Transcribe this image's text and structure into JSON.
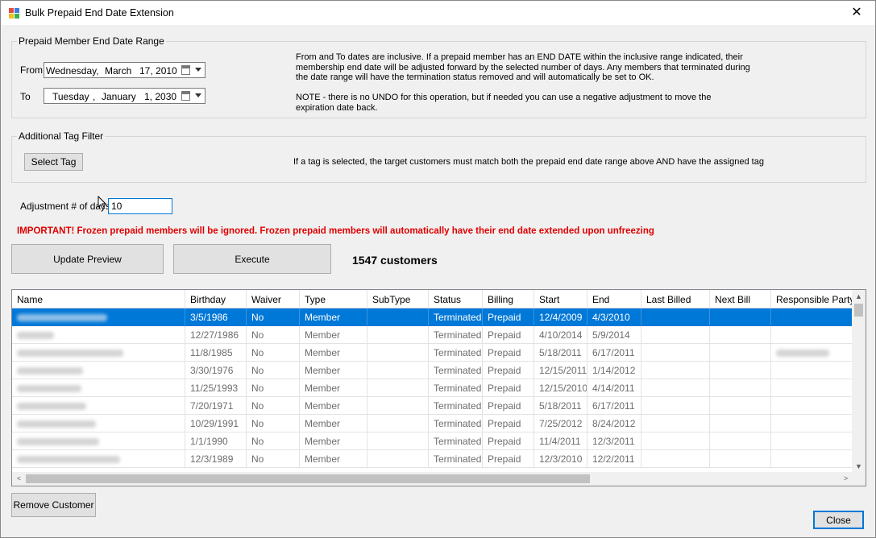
{
  "window": {
    "title": "Bulk Prepaid End Date Extension",
    "close_glyph": "✕"
  },
  "date_range": {
    "group_title": "Prepaid Member End Date Range",
    "from_label": "From",
    "from_weekday": "Wednesday,",
    "from_month": "March",
    "from_day": "17, 2010",
    "to_label": "To",
    "to_weekday": "Tuesday",
    "to_sep": ",",
    "to_month": "January",
    "to_day": "1, 2030",
    "info_lines": [
      "From and To dates are inclusive.  If a prepaid member has an END DATE within the inclusive range indicated, their",
      "membership end date will be adjusted forward by the selected number of days.  Any members that terminated during",
      "the date range will have the termination status removed and will automatically be set to OK.",
      "",
      "NOTE - there is no UNDO for this operation, but if needed you can use a negative adjustment to move the",
      "expiration date back."
    ]
  },
  "tag_filter": {
    "group_title": "Additional Tag Filter",
    "select_tag_label": "Select Tag",
    "info": "If a tag is selected, the target customers must match both the prepaid end date range above AND have the assigned tag"
  },
  "adjustment": {
    "label": "Adjustment # of days",
    "value": "10"
  },
  "important": "IMPORTANT!  Frozen prepaid members will be ignored.  Frozen prepaid members will automatically have their end date extended upon unfreezing",
  "actions": {
    "update_preview_label": "Update Preview",
    "execute_label": "Execute",
    "customer_count": "1547 customers"
  },
  "grid": {
    "columns": [
      "Name",
      "Birthday",
      "Waiver",
      "Type",
      "SubType",
      "Status",
      "Billing",
      "Start",
      "End",
      "Last Billed",
      "Next Bill",
      "Responsible Party"
    ],
    "rows": [
      {
        "birthday": "3/5/1986",
        "waiver": "No",
        "type": "Member",
        "subtype": "",
        "status": "Terminated",
        "billing": "Prepaid",
        "start": "12/4/2009",
        "end": "4/3/2010",
        "last_billed": "",
        "next_bill": "",
        "selected": true
      },
      {
        "birthday": "12/27/1986",
        "waiver": "No",
        "type": "Member",
        "subtype": "",
        "status": "Terminated",
        "billing": "Prepaid",
        "start": "4/10/2014",
        "end": "5/9/2014",
        "last_billed": "",
        "next_bill": "",
        "selected": false
      },
      {
        "birthday": "11/8/1985",
        "waiver": "No",
        "type": "Member",
        "subtype": "",
        "status": "Terminated",
        "billing": "Prepaid",
        "start": "5/18/2011",
        "end": "6/17/2011",
        "last_billed": "",
        "next_bill": "",
        "selected": false
      },
      {
        "birthday": "3/30/1976",
        "waiver": "No",
        "type": "Member",
        "subtype": "",
        "status": "Terminated",
        "billing": "Prepaid",
        "start": "12/15/2011",
        "end": "1/14/2012",
        "last_billed": "",
        "next_bill": "",
        "selected": false
      },
      {
        "birthday": "11/25/1993",
        "waiver": "No",
        "type": "Member",
        "subtype": "",
        "status": "Terminated",
        "billing": "Prepaid",
        "start": "12/15/2010",
        "end": "4/14/2011",
        "last_billed": "",
        "next_bill": "",
        "selected": false
      },
      {
        "birthday": "7/20/1971",
        "waiver": "No",
        "type": "Member",
        "subtype": "",
        "status": "Terminated",
        "billing": "Prepaid",
        "start": "5/18/2011",
        "end": "6/17/2011",
        "last_billed": "",
        "next_bill": "",
        "selected": false
      },
      {
        "birthday": "10/29/1991",
        "waiver": "No",
        "type": "Member",
        "subtype": "",
        "status": "Terminated",
        "billing": "Prepaid",
        "start": "7/25/2012",
        "end": "8/24/2012",
        "last_billed": "",
        "next_bill": "",
        "selected": false
      },
      {
        "birthday": "1/1/1990",
        "waiver": "No",
        "type": "Member",
        "subtype": "",
        "status": "Terminated",
        "billing": "Prepaid",
        "start": "11/4/2011",
        "end": "12/3/2011",
        "last_billed": "",
        "next_bill": "",
        "selected": false
      },
      {
        "birthday": "12/3/1989",
        "waiver": "No",
        "type": "Member",
        "subtype": "",
        "status": "Terminated",
        "billing": "Prepaid",
        "start": "12/3/2010",
        "end": "12/2/2011",
        "last_billed": "",
        "next_bill": "",
        "selected": false
      }
    ]
  },
  "footer": {
    "remove_customer_label": "Remove Customer",
    "close_label": "Close"
  },
  "scroll_glyphs": {
    "up": "▲",
    "down": "▼",
    "left": "<",
    "right": ">"
  },
  "colors": {
    "selection": "#0078d7",
    "important": "#e00000"
  }
}
